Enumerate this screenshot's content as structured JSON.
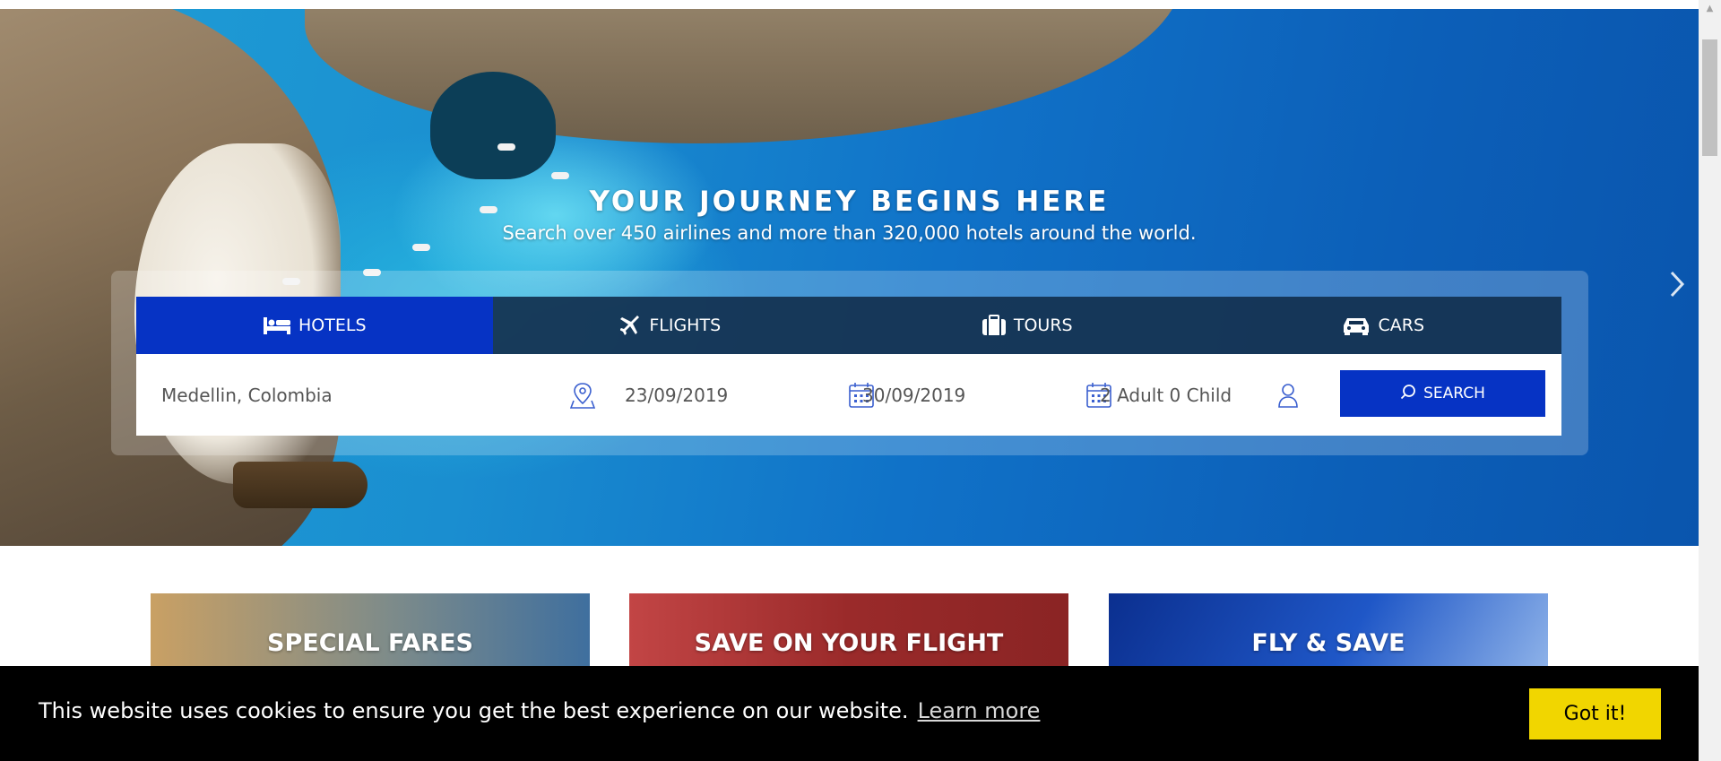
{
  "hero": {
    "title": "YOUR JOURNEY BEGINS HERE",
    "subtitle": "Search over 450 airlines and more than 320,000 hotels around the world."
  },
  "tabs": [
    {
      "label": "HOTELS",
      "icon": "bed-icon",
      "active": true
    },
    {
      "label": "FLIGHTS",
      "icon": "plane-icon",
      "active": false
    },
    {
      "label": "TOURS",
      "icon": "suitcase-icon",
      "active": false
    },
    {
      "label": "CARS",
      "icon": "car-icon",
      "active": false
    }
  ],
  "search": {
    "location_value": "Medellin, Colombia",
    "checkin_value": "23/09/2019",
    "checkout_value": "30/09/2019",
    "guests_value": "2 Adult 0 Child",
    "button_label": "SEARCH"
  },
  "promos": [
    {
      "title": "SPECIAL FARES"
    },
    {
      "title": "SAVE ON YOUR FLIGHT"
    },
    {
      "title": "FLY & SAVE"
    }
  ],
  "cookie": {
    "message": "This website uses cookies to ensure you get the best experience on our website.",
    "link_label": "Learn more",
    "button_label": "Got it!"
  },
  "colors": {
    "primary": "#0633c4",
    "tab_bar": "#123050",
    "cookie_button": "#f1d600"
  }
}
